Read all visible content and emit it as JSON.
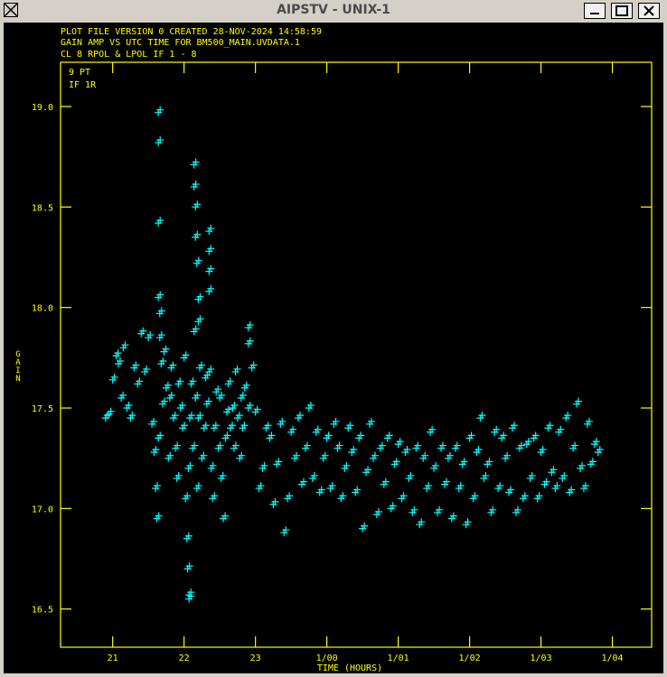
{
  "window": {
    "title": "AIPSTV - UNIX-1",
    "buttons": [
      "minimize",
      "maximize",
      "close"
    ]
  },
  "plot": {
    "header_lines": [
      "PLOT FILE VERSION 0  CREATED 28-NOV-2024 14:58:59",
      "GAIN AMP VS UTC TIME FOR BM500_MAIN.UVDATA.1",
      "CL 8  RPOL & LPOL  IF 1 - 8"
    ],
    "inner_labels": [
      "9 PT",
      "IF 1R"
    ],
    "colors": {
      "frame": "#ffff00",
      "points": "#00ffff",
      "background": "#000000"
    }
  },
  "chart_data": {
    "type": "scatter",
    "xlabel": "TIME (HOURS)",
    "ylabel": "GAIN",
    "x_tick_labels": [
      "21",
      "22",
      "23",
      "1/00",
      "1/01",
      "1/02",
      "1/03",
      "1/04"
    ],
    "x_tick_hours": [
      21,
      22,
      23,
      24,
      25,
      26,
      27,
      28
    ],
    "y_tick_labels": [
      "19.0",
      "18.5",
      "18.0",
      "17.5",
      "17.0",
      "16.5"
    ],
    "y_tick_values": [
      19.0,
      18.5,
      18.0,
      17.5,
      17.0,
      16.5
    ],
    "xlim": [
      20.27,
      28.55
    ],
    "ylim": [
      16.31,
      19.22
    ],
    "marker": "plus",
    "points": [
      [
        20.9,
        17.45
      ],
      [
        20.95,
        17.47
      ],
      [
        21.0,
        17.64
      ],
      [
        21.05,
        17.76
      ],
      [
        21.08,
        17.72
      ],
      [
        21.12,
        17.55
      ],
      [
        21.15,
        17.8
      ],
      [
        21.2,
        17.5
      ],
      [
        21.25,
        17.45
      ],
      [
        21.3,
        17.7
      ],
      [
        21.35,
        17.62
      ],
      [
        21.4,
        17.87
      ],
      [
        21.45,
        17.68
      ],
      [
        21.5,
        17.85
      ],
      [
        21.55,
        17.42
      ],
      [
        21.58,
        17.28
      ],
      [
        21.6,
        17.1
      ],
      [
        21.62,
        16.95
      ],
      [
        21.64,
        17.35
      ],
      [
        21.66,
        17.85
      ],
      [
        21.68,
        17.72
      ],
      [
        21.7,
        17.52
      ],
      [
        21.72,
        17.78
      ],
      [
        21.75,
        17.6
      ],
      [
        21.78,
        17.25
      ],
      [
        21.8,
        17.55
      ],
      [
        21.82,
        17.7
      ],
      [
        21.85,
        17.45
      ],
      [
        21.88,
        17.3
      ],
      [
        21.9,
        17.15
      ],
      [
        21.92,
        17.62
      ],
      [
        21.95,
        17.5
      ],
      [
        21.98,
        17.4
      ],
      [
        22.0,
        17.75
      ],
      [
        22.02,
        17.05
      ],
      [
        22.04,
        16.85
      ],
      [
        22.06,
        17.2
      ],
      [
        22.08,
        17.45
      ],
      [
        22.1,
        17.62
      ],
      [
        22.12,
        17.3
      ],
      [
        22.14,
        17.88
      ],
      [
        22.16,
        17.55
      ],
      [
        22.18,
        17.1
      ],
      [
        22.2,
        17.45
      ],
      [
        22.22,
        17.7
      ],
      [
        22.25,
        17.25
      ],
      [
        22.28,
        17.4
      ],
      [
        22.3,
        17.65
      ],
      [
        22.32,
        17.52
      ],
      [
        22.35,
        17.68
      ],
      [
        22.38,
        17.2
      ],
      [
        22.4,
        17.05
      ],
      [
        22.42,
        17.4
      ],
      [
        22.45,
        17.58
      ],
      [
        22.48,
        17.3
      ],
      [
        22.5,
        17.55
      ],
      [
        22.52,
        17.15
      ],
      [
        22.55,
        16.95
      ],
      [
        22.58,
        17.35
      ],
      [
        22.6,
        17.48
      ],
      [
        22.62,
        17.62
      ],
      [
        22.65,
        17.4
      ],
      [
        22.68,
        17.5
      ],
      [
        22.7,
        17.3
      ],
      [
        22.72,
        17.68
      ],
      [
        22.75,
        17.45
      ],
      [
        22.78,
        17.25
      ],
      [
        22.8,
        17.55
      ],
      [
        22.82,
        17.4
      ],
      [
        22.85,
        17.6
      ],
      [
        22.9,
        17.5
      ],
      [
        22.95,
        17.7
      ],
      [
        23.0,
        17.48
      ],
      [
        23.05,
        17.1
      ],
      [
        23.1,
        17.2
      ],
      [
        23.15,
        17.4
      ],
      [
        23.2,
        17.35
      ],
      [
        23.25,
        17.02
      ],
      [
        23.3,
        17.22
      ],
      [
        23.35,
        17.42
      ],
      [
        23.4,
        16.88
      ],
      [
        23.45,
        17.05
      ],
      [
        23.5,
        17.38
      ],
      [
        23.55,
        17.25
      ],
      [
        23.6,
        17.45
      ],
      [
        23.65,
        17.12
      ],
      [
        23.7,
        17.3
      ],
      [
        23.75,
        17.5
      ],
      [
        23.8,
        17.15
      ],
      [
        23.85,
        17.38
      ],
      [
        23.9,
        17.08
      ],
      [
        23.95,
        17.25
      ],
      [
        24.0,
        17.35
      ],
      [
        24.05,
        17.1
      ],
      [
        24.1,
        17.42
      ],
      [
        24.15,
        17.3
      ],
      [
        24.2,
        17.05
      ],
      [
        24.25,
        17.2
      ],
      [
        24.3,
        17.4
      ],
      [
        24.35,
        17.28
      ],
      [
        24.4,
        17.08
      ],
      [
        24.45,
        17.35
      ],
      [
        24.5,
        16.9
      ],
      [
        24.55,
        17.18
      ],
      [
        24.6,
        17.42
      ],
      [
        24.65,
        17.25
      ],
      [
        24.7,
        16.97
      ],
      [
        24.75,
        17.3
      ],
      [
        24.8,
        17.12
      ],
      [
        24.85,
        17.35
      ],
      [
        24.9,
        17.0
      ],
      [
        24.95,
        17.22
      ],
      [
        25.0,
        17.32
      ],
      [
        25.05,
        17.05
      ],
      [
        25.1,
        17.28
      ],
      [
        25.15,
        17.15
      ],
      [
        25.2,
        16.98
      ],
      [
        25.25,
        17.3
      ],
      [
        25.3,
        16.92
      ],
      [
        25.35,
        17.25
      ],
      [
        25.4,
        17.1
      ],
      [
        25.45,
        17.38
      ],
      [
        25.5,
        17.2
      ],
      [
        25.55,
        16.98
      ],
      [
        25.6,
        17.3
      ],
      [
        25.65,
        17.12
      ],
      [
        25.7,
        17.25
      ],
      [
        25.75,
        16.95
      ],
      [
        25.8,
        17.3
      ],
      [
        25.85,
        17.1
      ],
      [
        25.9,
        17.22
      ],
      [
        25.95,
        16.92
      ],
      [
        26.0,
        17.35
      ],
      [
        26.05,
        17.05
      ],
      [
        26.1,
        17.28
      ],
      [
        26.15,
        17.45
      ],
      [
        26.2,
        17.15
      ],
      [
        26.25,
        17.22
      ],
      [
        26.3,
        16.98
      ],
      [
        26.35,
        17.38
      ],
      [
        26.4,
        17.1
      ],
      [
        26.45,
        17.35
      ],
      [
        26.5,
        17.25
      ],
      [
        26.55,
        17.08
      ],
      [
        26.6,
        17.4
      ],
      [
        26.65,
        16.98
      ],
      [
        26.7,
        17.3
      ],
      [
        26.75,
        17.05
      ],
      [
        26.8,
        17.32
      ],
      [
        26.85,
        17.15
      ],
      [
        26.9,
        17.35
      ],
      [
        26.95,
        17.05
      ],
      [
        27.0,
        17.28
      ],
      [
        27.05,
        17.12
      ],
      [
        27.1,
        17.4
      ],
      [
        27.15,
        17.18
      ],
      [
        27.2,
        17.1
      ],
      [
        27.25,
        17.38
      ],
      [
        27.3,
        17.15
      ],
      [
        27.35,
        17.45
      ],
      [
        27.4,
        17.08
      ],
      [
        27.45,
        17.3
      ],
      [
        27.5,
        17.52
      ],
      [
        27.55,
        17.2
      ],
      [
        27.6,
        17.1
      ],
      [
        27.65,
        17.42
      ],
      [
        27.7,
        17.22
      ],
      [
        27.75,
        17.32
      ],
      [
        27.8,
        17.28
      ]
    ],
    "high_points": [
      [
        21.64,
        18.97
      ],
      [
        21.64,
        18.82
      ],
      [
        21.64,
        18.42
      ],
      [
        21.64,
        18.05
      ],
      [
        21.66,
        17.97
      ],
      [
        22.14,
        18.71
      ],
      [
        22.14,
        18.6
      ],
      [
        22.16,
        18.5
      ],
      [
        22.16,
        18.35
      ],
      [
        22.18,
        18.22
      ],
      [
        22.2,
        18.04
      ],
      [
        22.2,
        17.93
      ],
      [
        22.35,
        18.38
      ],
      [
        22.35,
        18.28
      ],
      [
        22.35,
        18.18
      ],
      [
        22.35,
        18.08
      ],
      [
        22.05,
        16.7
      ],
      [
        22.07,
        16.57
      ],
      [
        22.07,
        16.55
      ],
      [
        22.9,
        17.9
      ],
      [
        22.9,
        17.82
      ]
    ]
  }
}
